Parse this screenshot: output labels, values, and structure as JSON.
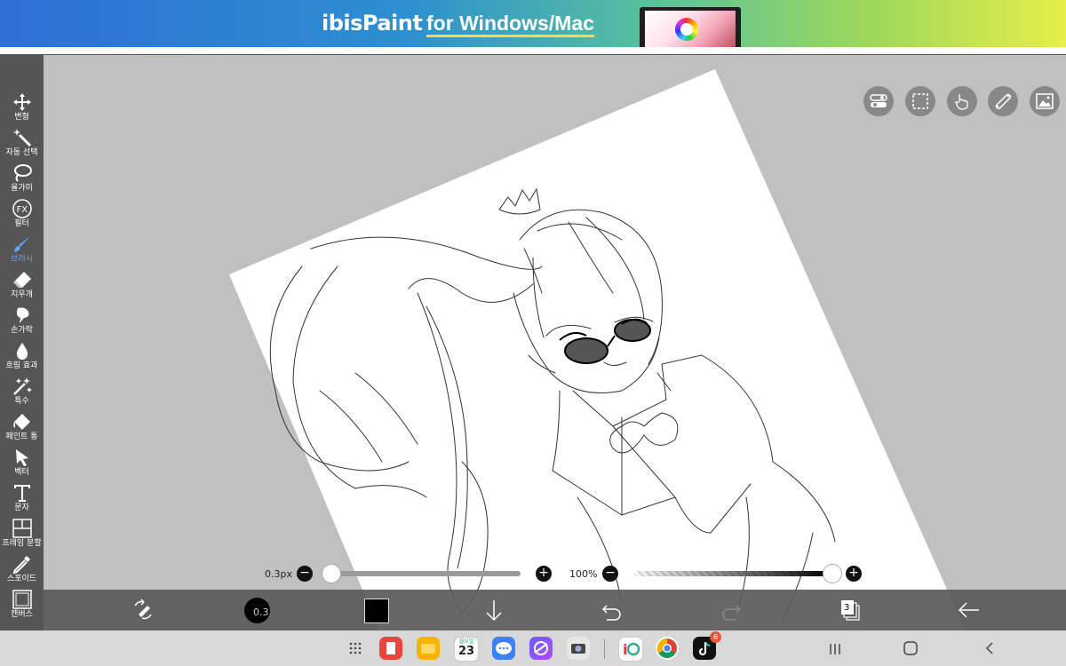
{
  "banner": {
    "brand": "ibisPaint",
    "tagline": "for Windows/Mac"
  },
  "toolbar": {
    "items": [
      {
        "label": "변형",
        "icon": "move-icon"
      },
      {
        "label": "자동 선택",
        "icon": "magic-wand-icon"
      },
      {
        "label": "올가미",
        "icon": "lasso-icon"
      },
      {
        "label": "필터",
        "icon": "fx-icon"
      },
      {
        "label": "브러시",
        "icon": "brush-icon",
        "active": true
      },
      {
        "label": "지우개",
        "icon": "eraser-icon"
      },
      {
        "label": "손가락",
        "icon": "smudge-icon"
      },
      {
        "label": "흐림 효과",
        "icon": "blur-drop-icon"
      },
      {
        "label": "특수",
        "icon": "sparkle-icon"
      },
      {
        "label": "페인트 통",
        "icon": "paint-bucket-icon"
      },
      {
        "label": "벡터",
        "icon": "vector-arrow-icon"
      },
      {
        "label": "문자",
        "icon": "text-icon"
      },
      {
        "label": "프레임 분할",
        "icon": "frame-divider-icon"
      },
      {
        "label": "스포이드",
        "icon": "eyedropper-icon"
      },
      {
        "label": "캔버스",
        "icon": "canvas-icon"
      }
    ],
    "active_color": "#5aa7ff"
  },
  "brush_size": {
    "value": "0.3px",
    "level": 0.0
  },
  "opacity": {
    "value": "100%",
    "level": 1.0
  },
  "bottom": {
    "brush_preview_value": "0.3",
    "color": "#000000",
    "layers_count": "3"
  },
  "taskbar": {
    "calendar_day": "23",
    "calendar_weekday": "월요일",
    "tiktok_badge": "6"
  }
}
